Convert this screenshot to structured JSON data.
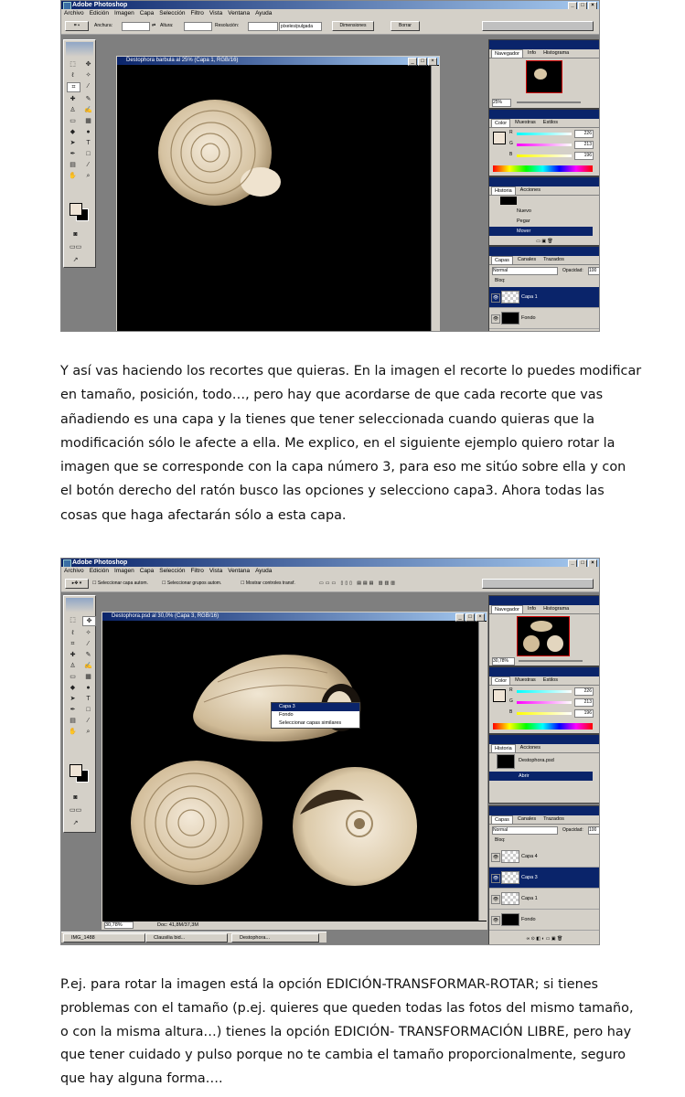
{
  "screenshot1": {
    "app_title": "Adobe Photoshop",
    "menu": [
      "Archivo",
      "Edición",
      "Imagen",
      "Capa",
      "Selección",
      "Filtro",
      "Vista",
      "Ventana",
      "Ayuda"
    ],
    "options": {
      "width_label": "Anchura:",
      "height_label": "Altura:",
      "resolution_label": "Resolución:",
      "resolution_unit": "píxeles/pulgada",
      "front_image_button": "Dimensiones",
      "clear_button": "Borrar"
    },
    "doc_title": "Destophora barbula al 25% (Capa 1, RGB/16)",
    "navigator": {
      "tabs": [
        "Navegador",
        "Info",
        "Histograma"
      ],
      "zoom": "25%"
    },
    "color": {
      "tabs": [
        "Color",
        "Muestras",
        "Estilos"
      ],
      "R": "226",
      "G": "213",
      "B": "196"
    },
    "history": {
      "tabs": [
        "Historia",
        "Acciones"
      ],
      "items": [
        "Nuevo",
        "Pegar",
        "Mover"
      ]
    },
    "layers": {
      "tabs": [
        "Capas",
        "Canales",
        "Trazados"
      ],
      "mode": "Normal",
      "opacity_label": "Opacidad:",
      "opacity": "100",
      "lock_label": "Bloq:",
      "rows": [
        {
          "name": "Capa 1",
          "selected": true,
          "thumb": "checker"
        },
        {
          "name": "Fondo",
          "selected": false,
          "thumb": "black"
        }
      ]
    },
    "colors": {
      "titlebar": "#0a246a",
      "panel": "#d4d0c8",
      "canvas": "#000000"
    }
  },
  "paragraph1": "Y así vas haciendo los recortes que quieras. En la imagen el recorte lo puedes modificar\nen tamaño, posición, todo…, pero hay que acordarse de que cada recorte que vas\nañadiendo es una capa y la tienes que tener seleccionada cuando quieras que la\nmodificación sólo le afecte a ella. Me explico, en el siguiente ejemplo quiero rotar la\nimagen que se corresponde con la capa número 3, para eso me sitúo sobre ella y con\nel botón derecho del ratón busco las opciones y selecciono capa3. Ahora todas las\ncosas que haga afectarán sólo a esta capa.",
  "screenshot2": {
    "app_title": "Adobe Photoshop",
    "menu": [
      "Archivo",
      "Edición",
      "Imagen",
      "Capa",
      "Selección",
      "Filtro",
      "Vista",
      "Ventana",
      "Ayuda"
    ],
    "options": {
      "auto_select_layer": "Seleccionar capa autom.",
      "auto_select_group": "Seleccionar grupos autom.",
      "show_bounding_box": "Mostrar controles transf."
    },
    "doc_title": "Destophora.psd al 30,0% (Capa 3, RGB/16)",
    "context_menu": [
      "Capa 3",
      "Fondo",
      "Seleccionar capas similares"
    ],
    "zoom_status": "30,78%",
    "doc_status": "Doc: 41,8M/37,3M",
    "navigator": {
      "tabs": [
        "Navegador",
        "Info",
        "Histograma"
      ],
      "zoom": "30,78%"
    },
    "color": {
      "tabs": [
        "Color",
        "Muestras",
        "Estilos"
      ],
      "R": "226",
      "G": "213",
      "B": "196"
    },
    "history": {
      "tabs": [
        "Historia",
        "Acciones"
      ],
      "items": [
        "Destophora.psd",
        "Abrir"
      ]
    },
    "layers": {
      "tabs": [
        "Capas",
        "Canales",
        "Trazados"
      ],
      "mode": "Normal",
      "opacity_label": "Opacidad:",
      "opacity": "100",
      "lock_label": "Bloq:",
      "rows": [
        {
          "name": "Capa 4",
          "selected": false,
          "thumb": "checker"
        },
        {
          "name": "Capa 3",
          "selected": true,
          "thumb": "checker"
        },
        {
          "name": "Capa 1",
          "selected": false,
          "thumb": "checker"
        },
        {
          "name": "Fondo",
          "selected": false,
          "thumb": "black"
        }
      ]
    },
    "taskbar": [
      "IMG_1488",
      "Clausilia bid...",
      "Destophora..."
    ]
  },
  "paragraph2": "P.ej. para rotar la imagen está la opción EDICIÓN-TRANSFORMAR-ROTAR; si tienes\nproblemas con el tamaño (p.ej. quieres que queden todas las fotos del mismo tamaño,\no con la misma altura…) tienes la opción EDICIÓN- TRANSFORMACIÓN LIBRE, pero hay\nque tener cuidado y pulso porque no te cambia el tamaño proporcionalmente, seguro\nque hay alguna forma…."
}
